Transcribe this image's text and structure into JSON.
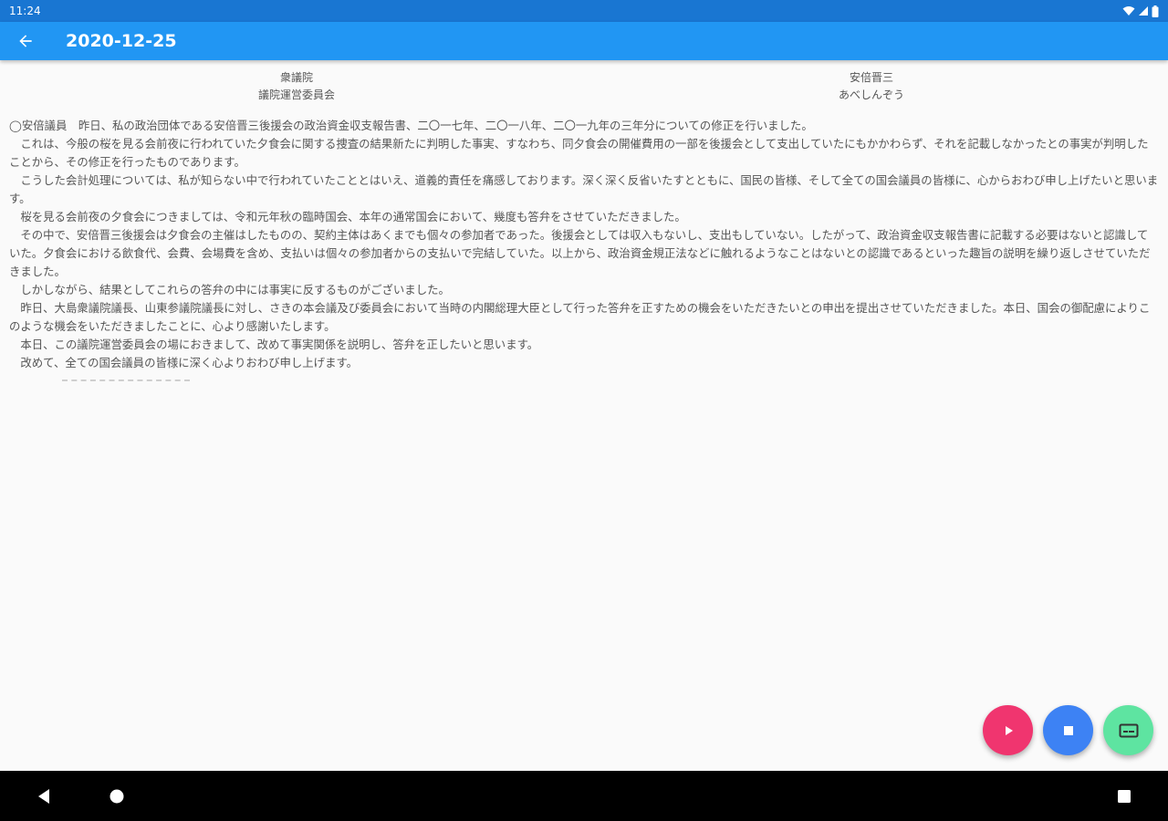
{
  "status": {
    "time": "11:24"
  },
  "app_bar": {
    "title": "2020-12-25",
    "back_icon": "arrow-back-icon"
  },
  "header": {
    "left": {
      "house": "衆議院",
      "committee": "議院運営委員会"
    },
    "right": {
      "speaker": "安倍晋三",
      "reading": "あべしんぞう"
    }
  },
  "speech": {
    "paragraphs": [
      "◯安倍議員　昨日、私の政治団体である安倍晋三後援会の政治資金収支報告書、二〇一七年、二〇一八年、二〇一九年の三年分についての修正を行いました。",
      "これは、今般の桜を見る会前夜に行われていた夕食会に関する捜査の結果新たに判明した事実、すなわち、同夕食会の開催費用の一部を後援会として支出していたにもかかわらず、それを記載しなかったとの事実が判明したことから、その修正を行ったものであります。",
      "こうした会計処理については、私が知らない中で行われていたこととはいえ、道義的責任を痛感しております。深く深く反省いたすとともに、国民の皆様、そして全ての国会議員の皆様に、心からおわび申し上げたいと思います。",
      "桜を見る会前夜の夕食会につきましては、令和元年秋の臨時国会、本年の通常国会において、幾度も答弁をさせていただきました。",
      "その中で、安倍晋三後援会は夕食会の主催はしたものの、契約主体はあくまでも個々の参加者であった。後援会としては収入もないし、支出もしていない。したがって、政治資金収支報告書に記載する必要はないと認識していた。夕食会における飲食代、会費、会場費を含め、支払いは個々の参加者からの支払いで完結していた。以上から、政治資金規正法などに触れるようなことはないとの認識であるといった趣旨の説明を繰り返しさせていただきました。",
      "しかしながら、結果としてこれらの答弁の中には事実に反するものがございました。",
      "昨日、大島衆議院議長、山東参議院議長に対し、さきの本会議及び委員会において当時の内閣総理大臣として行った答弁を正すための機会をいただきたいとの申出を提出させていただきました。本日、国会の御配慮によりこのような機会をいただきましたことに、心より感謝いたします。",
      "本日、この議院運営委員会の場におきまして、改めて事実関係を説明し、答弁を正したいと思います。",
      "改めて、全ての国会議員の皆様に深く心よりおわび申し上げます。"
    ]
  },
  "fabs": {
    "play_icon": "play-icon",
    "stop_icon": "stop-icon",
    "subtitles_icon": "subtitles-icon"
  },
  "colors": {
    "status_bar": "#1976d2",
    "app_bar": "#2196f3",
    "fab_play": "#f0356f",
    "fab_stop": "#3d82f4",
    "fab_subtitles": "#5ee4a1"
  }
}
